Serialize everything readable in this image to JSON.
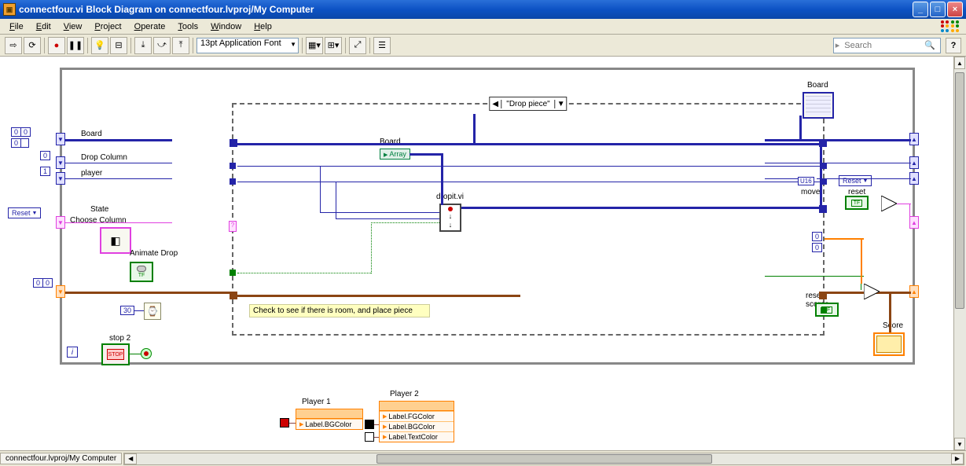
{
  "window": {
    "title": "connectfour.vi Block Diagram on connectfour.lvproj/My Computer",
    "icon_char": "▣"
  },
  "menus": [
    "File",
    "Edit",
    "View",
    "Project",
    "Operate",
    "Tools",
    "Window",
    "Help"
  ],
  "toolbar": {
    "font": "13pt Application Font",
    "search_placeholder": "Search"
  },
  "case_selector": {
    "label": "\"Drop piece\"",
    "left_arrow": "◀",
    "right_arrow": "▼"
  },
  "labels": {
    "board_top": "Board",
    "board_sr": "Board",
    "board_inner": "Board",
    "drop_column": "Drop Column",
    "player": "player",
    "state": "State",
    "choose_column": "Choose Column",
    "animate_drop": "Animate Drop",
    "dropit": "dropit.vi",
    "array": "Array",
    "reset_scores": "reset scores",
    "move": "move",
    "reset": "reset",
    "score": "Score",
    "stop2": "stop 2",
    "player1": "Player 1",
    "player2": "Player 2",
    "reset_ring": "Reset",
    "u16": "U16",
    "tf": "TF",
    "stop": "STOP",
    "wait_val": "30",
    "label_bgcolor": "Label.BGColor",
    "label_fgcolor": "Label.FGColor",
    "label_textcolor": "Label.TextColor"
  },
  "constants": {
    "zero": "0",
    "one": "1"
  },
  "comment": "Check to see if there is room, and place piece",
  "statusbar": {
    "path": "connectfour.lvproj/My Computer"
  }
}
